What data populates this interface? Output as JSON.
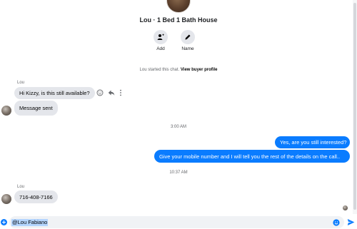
{
  "conversation": {
    "title": "Lou · 1 Bed 1 Bath House",
    "actions": [
      {
        "label": "Add",
        "icon": "add-person-icon"
      },
      {
        "label": "Name",
        "icon": "pencil-icon"
      }
    ],
    "system_line_prefix": "Lou started this chat.",
    "system_line_link": "View buyer profile"
  },
  "messages": {
    "group1_sender": "Lou",
    "msg1": "Hi Kizzy, is this still available?",
    "msg2": "Message sent",
    "time1": "3:00 AM",
    "out1": "Yes, are you still interested?",
    "out2": "Give your mobile number and I will tell you the rest of the details on the call..",
    "time2": "10:37 AM",
    "group2_sender": "Lou",
    "msg3": "716-408-7166"
  },
  "composer": {
    "value": "@Lou Fabiano"
  },
  "colors": {
    "accent": "#0a7cff",
    "incoming_bubble": "#e4e6eb",
    "muted_text": "#65676b"
  }
}
